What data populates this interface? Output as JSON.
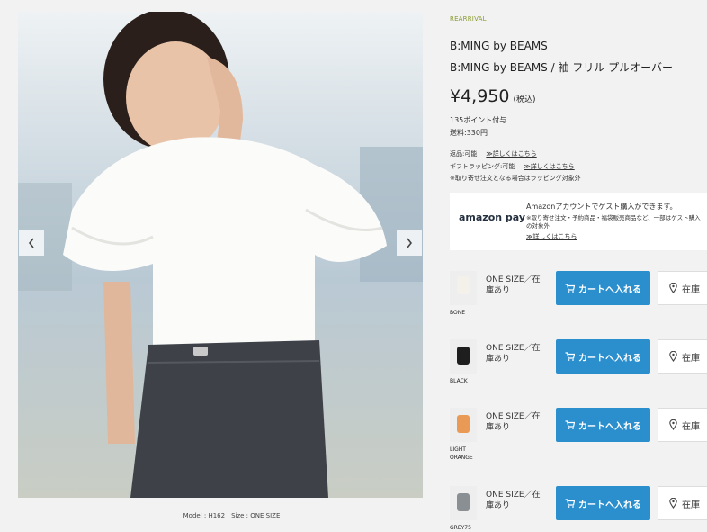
{
  "product": {
    "label_small": "REARRIVAL",
    "brand": "B:MING by BEAMS",
    "title": "B:MING by BEAMS / 袖 フリル プルオーバー",
    "price": "¥4,950",
    "tax": "(税込)",
    "points": "135ポイント付与",
    "shipping": "送料:330円"
  },
  "info": {
    "returns": "返品:可能",
    "returns_link": "≫詳しくはこちら",
    "wrapping": "ギフトラッピング:可能",
    "wrapping_link": "≫詳しくはこちら",
    "note": "※取り寄せ注文となる場合はラッピング対象外"
  },
  "amazon": {
    "logo": "amazon pay",
    "headline": "Amazonアカウントでゲスト購入ができます。",
    "sub": "※取り寄せ注文・予約商品・福袋販売商品など、一部はゲスト購入の対象外",
    "link": "≫詳しくはこちら"
  },
  "gallery": {
    "caption": "Model : H162　Size : ONE SIZE",
    "prev": "‹",
    "next": "›"
  },
  "variants": [
    {
      "color": "BONE",
      "stock": "ONE SIZE／在庫あり",
      "cart": "カートへ入れる",
      "store": "在庫",
      "swatch": "#f4f1ea"
    },
    {
      "color": "BLACK",
      "stock": "ONE SIZE／在庫あり",
      "cart": "カートへ入れる",
      "store": "在庫",
      "swatch": "#1e1e1e"
    },
    {
      "color": "LIGHT ORANGE",
      "stock": "ONE SIZE／在庫あり",
      "cart": "カートへ入れる",
      "store": "在庫",
      "swatch": "#e99a55"
    },
    {
      "color": "GREY75",
      "stock": "ONE SIZE／在庫あり",
      "cart": "カートへ入れる",
      "store": "在庫",
      "swatch": "#8a8f94"
    }
  ],
  "colors": {
    "accent": "#2b8fce",
    "brand_small": "#8a9a2e"
  }
}
